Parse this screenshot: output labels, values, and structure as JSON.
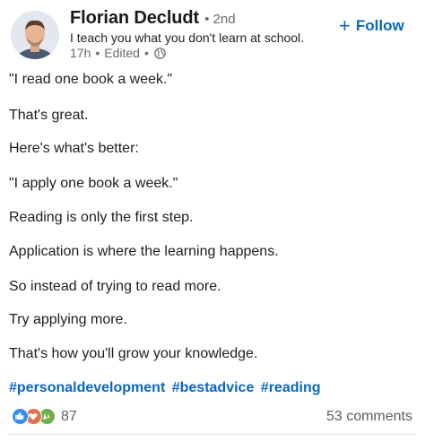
{
  "author": {
    "name": "Florian Decludt",
    "degree_separator": "•",
    "degree": "2nd",
    "headline": "I teach you what you don't learn at school.",
    "time": "17h",
    "edited": "Edited",
    "meta_separator": "•",
    "visibility_icon": "globe-icon"
  },
  "follow": {
    "plus": "+",
    "label": "Follow"
  },
  "post": {
    "lines": [
      "\"I read one book a week.\"",
      "That's great.",
      "Here's what's better:",
      "\"I apply one book a week.\"",
      "Reading is only the first step.",
      "Application is where the learning happens.",
      "So instead of trying to read more.",
      "Try applying more.",
      "That's how you'll grow your knowledge."
    ],
    "hashtags": [
      "#personaldevelopment",
      "#bestadvice",
      "#reading"
    ]
  },
  "social": {
    "reaction_icons": [
      "like-icon",
      "love-icon",
      "celebrate-icon"
    ],
    "reaction_count": "87",
    "comments": "53 comments"
  },
  "colors": {
    "link_blue": "#0a66c2",
    "like": "#378fe9",
    "love": "#df704d",
    "celebrate": "#6dae4f"
  }
}
